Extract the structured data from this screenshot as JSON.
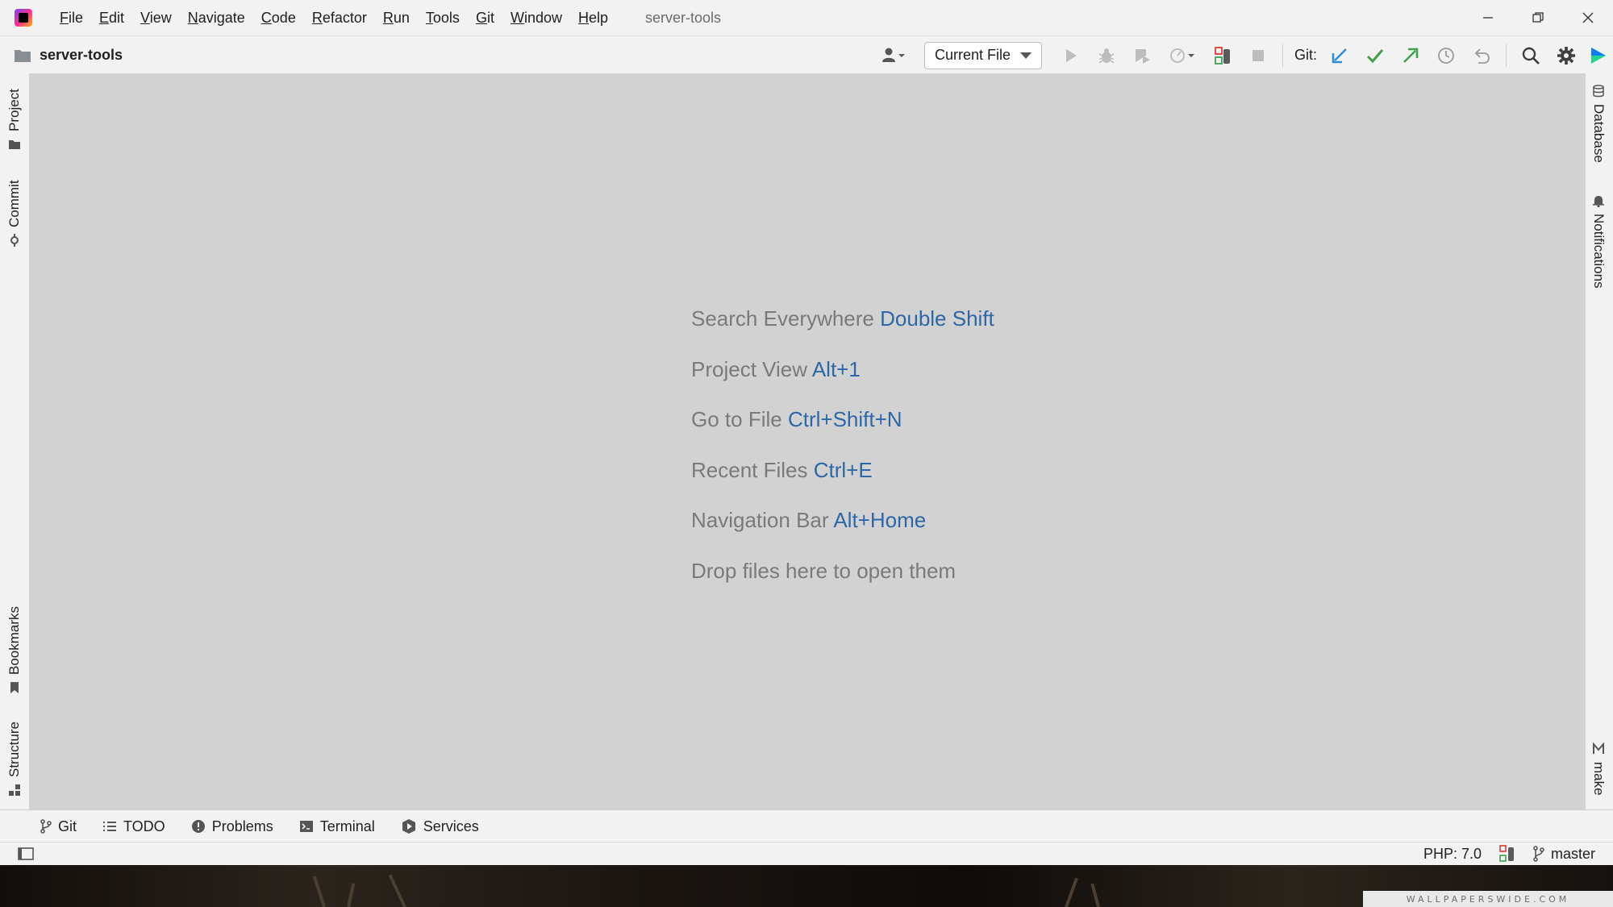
{
  "menubar": {
    "items": [
      "File",
      "Edit",
      "View",
      "Navigate",
      "Code",
      "Refactor",
      "Run",
      "Tools",
      "Git",
      "Window",
      "Help"
    ],
    "window_title": "server-tools"
  },
  "toolbar": {
    "project_name": "server-tools",
    "run_config": "Current File",
    "git_label": "Git:"
  },
  "left_tabs": {
    "project": "Project",
    "commit": "Commit",
    "bookmarks": "Bookmarks",
    "structure": "Structure"
  },
  "right_tabs": {
    "database": "Database",
    "notifications": "Notifications",
    "make": "make"
  },
  "editor_hints": [
    {
      "text": "Search Everywhere",
      "shortcut": "Double Shift"
    },
    {
      "text": "Project View",
      "shortcut": "Alt+1"
    },
    {
      "text": "Go to File",
      "shortcut": "Ctrl+Shift+N"
    },
    {
      "text": "Recent Files",
      "shortcut": "Ctrl+E"
    },
    {
      "text": "Navigation Bar",
      "shortcut": "Alt+Home"
    },
    {
      "text": "Drop files here to open them",
      "shortcut": ""
    }
  ],
  "bottom_tabs": {
    "git": "Git",
    "todo": "TODO",
    "problems": "Problems",
    "terminal": "Terminal",
    "services": "Services"
  },
  "statusbar": {
    "php_version": "PHP: 7.0",
    "branch": "master"
  },
  "wallpaper_watermark": "WALLPAPERSWIDE.COM",
  "colors": {
    "shortcut_blue": "#2d67a8",
    "git_update_blue": "#2d8fd8",
    "git_commit_green": "#3fa14a",
    "git_push_green": "#3fa14a"
  }
}
